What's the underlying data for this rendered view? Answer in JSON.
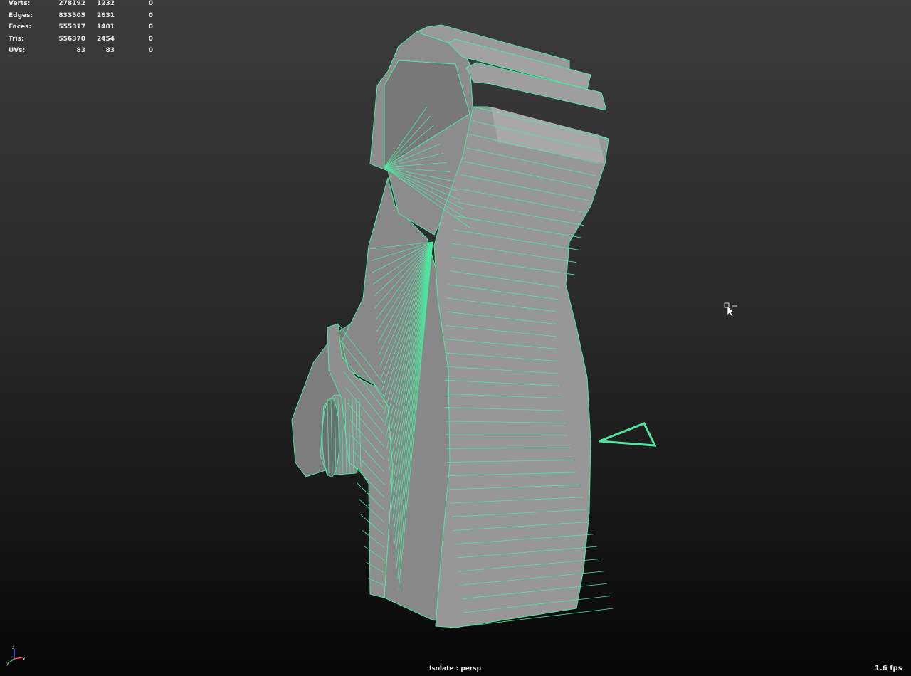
{
  "hud": {
    "rows": [
      {
        "label": "Verts:",
        "v1": "278192",
        "v2": "1232",
        "v3": "0"
      },
      {
        "label": "Edges:",
        "v1": "833505",
        "v2": "2631",
        "v3": "0"
      },
      {
        "label": "Faces:",
        "v1": "555317",
        "v2": "1401",
        "v3": "0"
      },
      {
        "label": "Tris:",
        "v1": "556370",
        "v2": "2454",
        "v3": "0"
      },
      {
        "label": "UVs:",
        "v1": "83",
        "v2": "83",
        "v3": "0"
      }
    ]
  },
  "viewport": {
    "camera_label": "Isolate : persp",
    "fps": "1.6 fps",
    "axis_labels": {
      "x": "x",
      "y": "y",
      "z": "z"
    }
  },
  "colors": {
    "wire": "#4ee6a0",
    "mesh": "#8e8e8e",
    "mesh_dark": "#6f6f6f",
    "mesh_light": "#a6a6a6"
  },
  "icons": [
    "axis-gizmo-icon",
    "mouse-cursor-icon",
    "selection-marquee-icon"
  ]
}
